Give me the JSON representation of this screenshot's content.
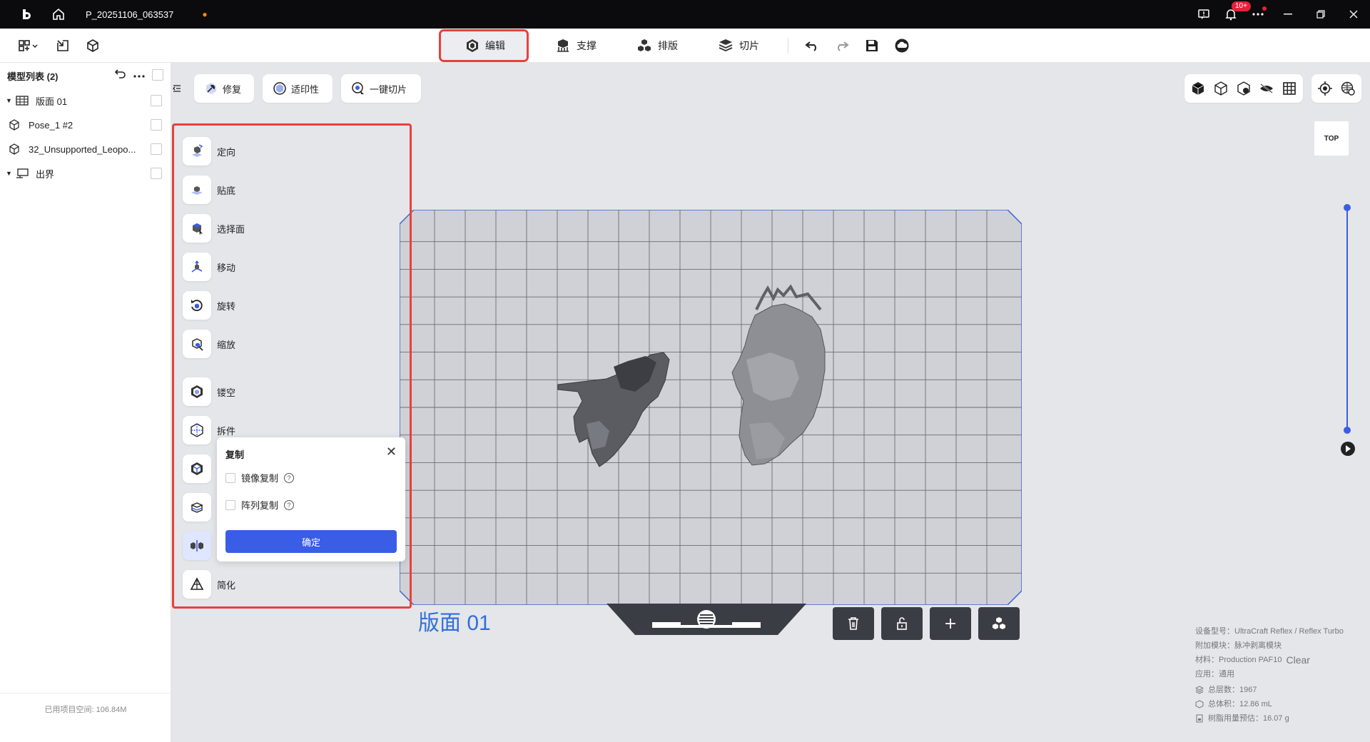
{
  "titlebar": {
    "project_name": "P_20251106_063537",
    "unsaved_dot": "●",
    "notification_badge": "10+"
  },
  "toolbar": {
    "tabs": [
      {
        "label": "编辑",
        "icon": "edit-cube-icon",
        "active": true
      },
      {
        "label": "支撑",
        "icon": "support-icon",
        "active": false
      },
      {
        "label": "排版",
        "icon": "layout-icon",
        "active": false
      },
      {
        "label": "切片",
        "icon": "slice-layers-icon",
        "active": false
      }
    ]
  },
  "sidebar": {
    "title": "模型列表 (2)",
    "items": [
      {
        "label": "版面 01",
        "icon": "plate-icon",
        "expandable": true
      },
      {
        "label": "Pose_1 #2",
        "icon": "model-cube-icon",
        "expandable": false
      },
      {
        "label": "32_Unsupported_Leopo...",
        "icon": "model-cube-icon",
        "expandable": false
      },
      {
        "label": "出界",
        "icon": "out-of-bounds-icon",
        "expandable": true
      }
    ],
    "footer": "已用项目空间: 106.84M"
  },
  "viewport_buttons": {
    "repair": "修复",
    "printability": "适印性",
    "one_click_slice": "一键切片"
  },
  "tools": [
    {
      "label": "定向"
    },
    {
      "label": "贴底"
    },
    {
      "label": "选择面"
    },
    {
      "label": "移动"
    },
    {
      "label": "旋转"
    },
    {
      "label": "缩放"
    },
    {
      "label": "镂空"
    },
    {
      "label": "拆件"
    },
    {
      "label": ""
    },
    {
      "label": ""
    },
    {
      "label": ""
    },
    {
      "label": "简化"
    }
  ],
  "copy_popup": {
    "title": "复制",
    "mirror_copy": "镜像复制",
    "array_copy": "阵列复制",
    "confirm": "确定"
  },
  "plate": {
    "label": "版面 01",
    "grid_cols": 20,
    "grid_rows": 14
  },
  "view": {
    "top_label": "TOP"
  },
  "info": {
    "device": "设备型号：UltraCraft Reflex / Reflex Turbo",
    "module": "附加模块：脉冲剥离模块",
    "material_prefix": "材料：Production PAF10",
    "material_suffix": "Clear",
    "application": "应用：通用",
    "total_layers": "总层数：1967",
    "total_volume": "总体积：12.86 mL",
    "resin_estimate": "树脂用量预估：16.07 g"
  },
  "colors": {
    "accent": "#3a5de6",
    "highlight_border": "#e8413c",
    "plate_label": "#2f6fdc"
  }
}
